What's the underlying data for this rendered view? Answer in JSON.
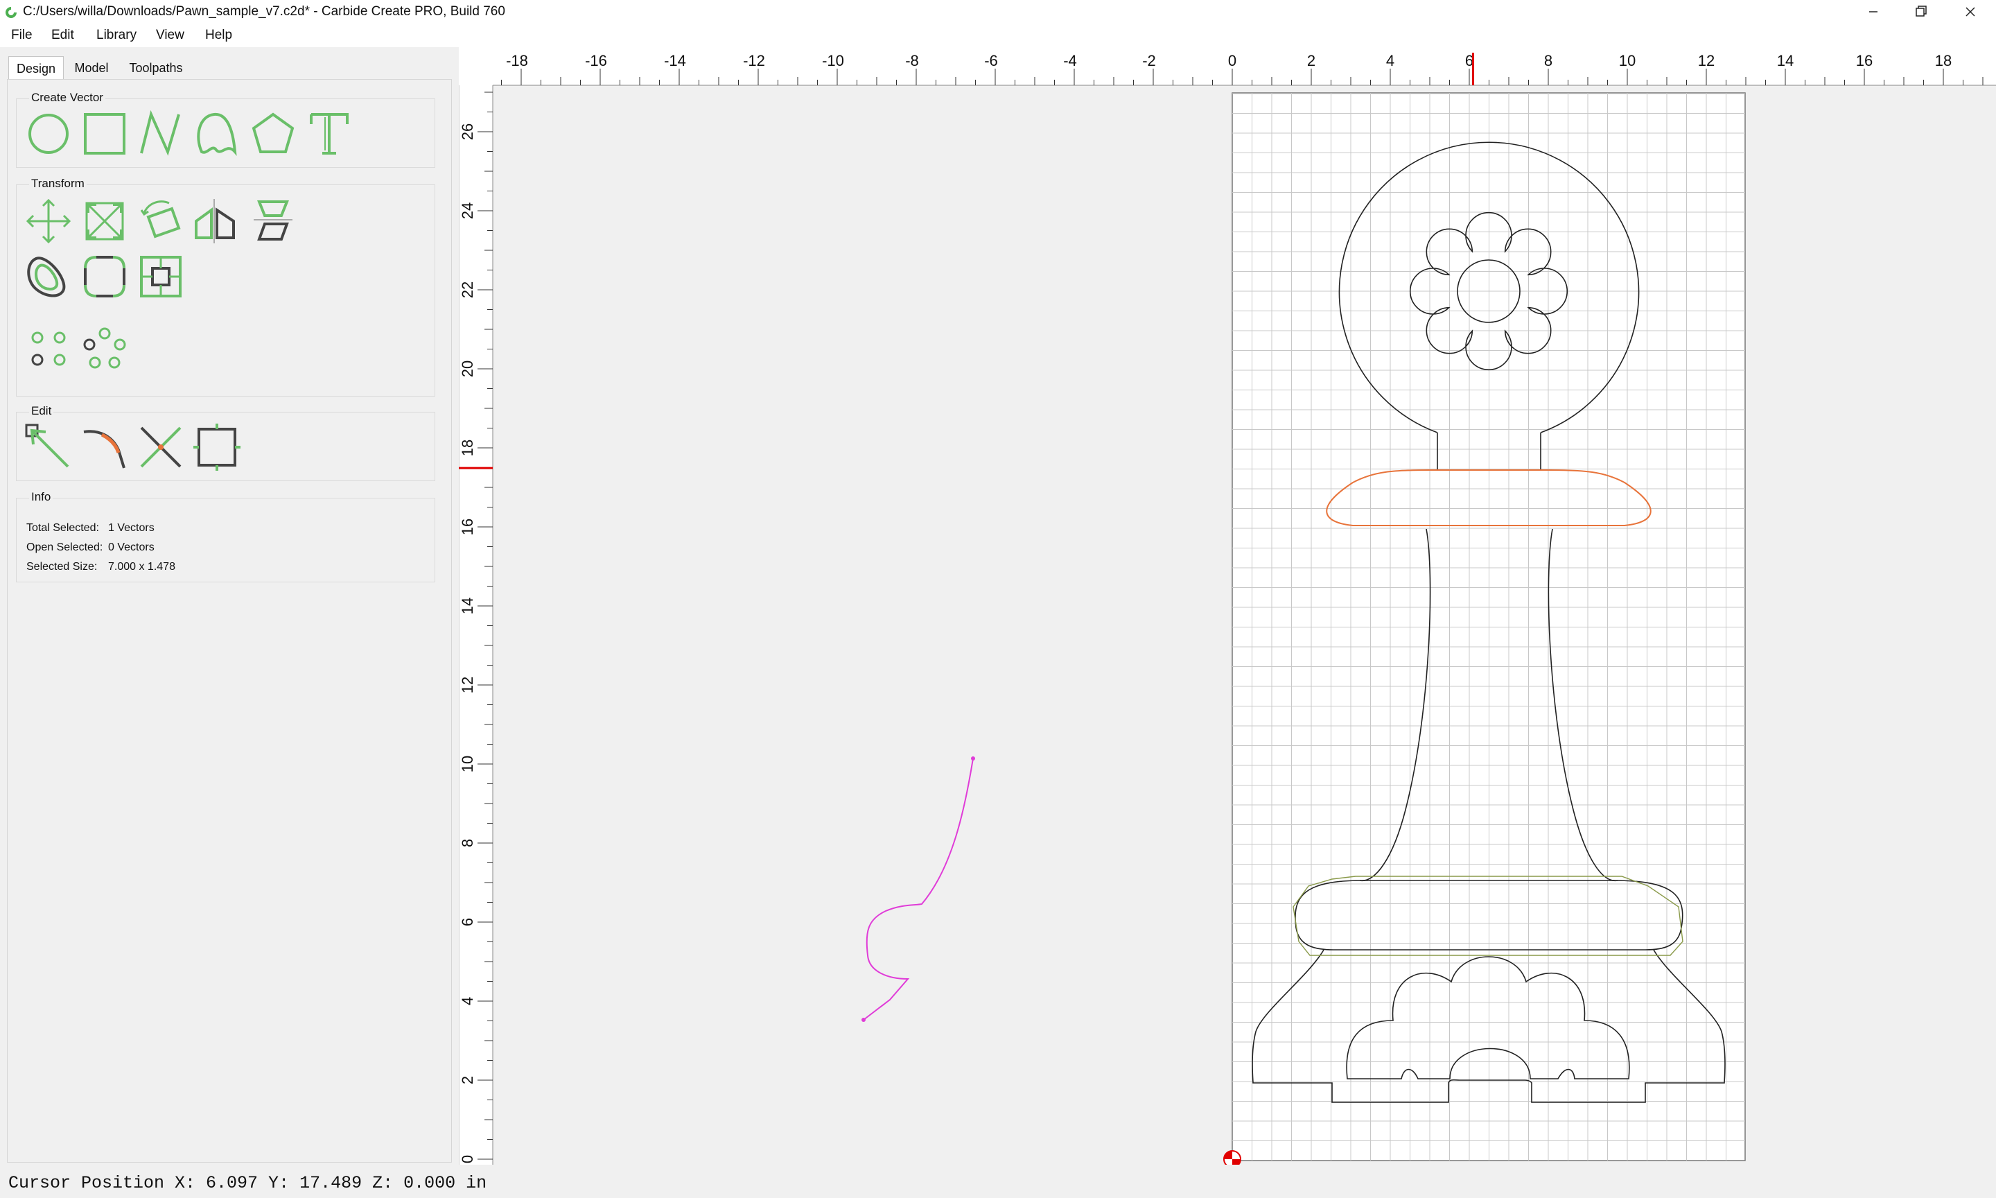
{
  "window": {
    "title": "C:/Users/willa/Downloads/Pawn_sample_v7.c2d* - Carbide Create PRO, Build 760"
  },
  "menu": [
    {
      "label": "File",
      "key": "file"
    },
    {
      "label": "Edit",
      "key": "edit"
    },
    {
      "label": "Library",
      "key": "library"
    },
    {
      "label": "View",
      "key": "view"
    },
    {
      "label": "Help",
      "key": "help"
    }
  ],
  "tabs": {
    "design": "Design",
    "model": "Model",
    "toolpaths": "Toolpaths",
    "active": "Design"
  },
  "groups": {
    "create_vector": {
      "title": "Create Vector",
      "tools": [
        "circle-icon",
        "rectangle-icon",
        "polyline-icon",
        "curve-icon",
        "polygon-icon",
        "text-icon"
      ]
    },
    "transform": {
      "title": "Transform",
      "tools": [
        "move-icon",
        "scale-icon",
        "rotate-icon",
        "mirror-icon",
        "align-icon",
        "offset-icon",
        "fillet-icon",
        "boolean-icon",
        "grid-array-icon",
        "circular-array-icon"
      ]
    },
    "edit": {
      "title": "Edit",
      "tools": [
        "node-edit-icon",
        "trim-icon",
        "cut-icon",
        "bounding-box-icon"
      ]
    },
    "info": {
      "title": "Info",
      "total_selected_label": "Total Selected:",
      "total_selected_value": "1 Vectors",
      "open_selected_label": "Open Selected:",
      "open_selected_value": "0 Vectors",
      "selected_size_label": "Selected Size:",
      "selected_size_value": "7.000 x 1.478"
    }
  },
  "canvas": {
    "x_ticks": [
      "-18",
      "-16",
      "-14",
      "-12",
      "-10",
      "-8",
      "-6",
      "-4",
      "-2",
      "0",
      "2",
      "4",
      "6",
      "8",
      "10",
      "12",
      "14",
      "16",
      "18"
    ],
    "y_ticks": [
      "0",
      "2",
      "4",
      "6",
      "8",
      "10",
      "12",
      "14",
      "16",
      "18",
      "20",
      "22",
      "24",
      "26"
    ],
    "cursor_marker": {
      "x": 6.097,
      "y": 17.489
    },
    "colors": {
      "selection": "#e8743b",
      "toolpath": "#8a9a4a",
      "magenta_path": "#e03cd8",
      "vector": "#222222",
      "tool_green": "#6abf69",
      "tool_dark": "#444444",
      "marker_red": "#e00000"
    }
  },
  "status": {
    "cursor_position": "Cursor Position X: 6.097 Y: 17.489 Z: 0.000 in"
  }
}
